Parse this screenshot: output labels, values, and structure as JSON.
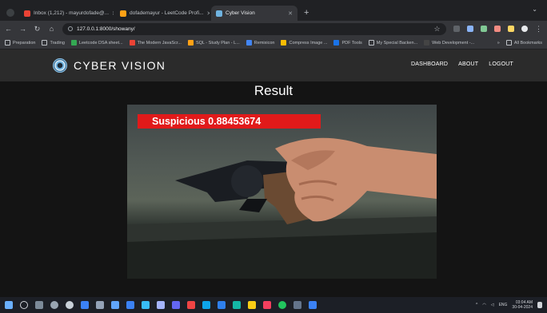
{
  "browser": {
    "tabs": [
      {
        "title": "Inbox (1,212) - mayurdofade@...",
        "favicon_color": "#ea4335",
        "active": false
      },
      {
        "title": "dofademayur - LeetCode Profi...",
        "favicon_color": "#ffa116",
        "active": false
      },
      {
        "title": "Cyber Vision",
        "favicon_color": "#6fb3e0",
        "active": true
      }
    ],
    "new_tab_glyph": "+",
    "window_menu_glyph": "⌄",
    "address": "127.0.0.1:8000/showany/",
    "bookmarks": [
      {
        "label": "Preparation",
        "icon_color": "#bdc1c6"
      },
      {
        "label": "Trading",
        "icon_color": "#bdc1c6"
      },
      {
        "label": "Leetcode DSA sheet...",
        "icon_color": "#34a853"
      },
      {
        "label": "The Modern JavaScr...",
        "icon_color": "#ea4335"
      },
      {
        "label": "SQL - Study Plan - L...",
        "icon_color": "#ffa116"
      },
      {
        "label": "Remixicon",
        "icon_color": "#4285f4"
      },
      {
        "label": "Compress Image ...",
        "icon_color": "#fbbc04"
      },
      {
        "label": "PDF Tools",
        "icon_color": "#1a73e8"
      },
      {
        "label": "My Special Backen...",
        "icon_color": "#bdc1c6"
      },
      {
        "label": "Web Development -...",
        "icon_color": "#444444"
      }
    ],
    "bookmarks_overflow": "»",
    "all_bookmarks": "All Bookmarks"
  },
  "site": {
    "brand": "CYBER VISION",
    "nav": [
      "DASHBOARD",
      "ABOUT",
      "LOGOUT"
    ],
    "heading": "Result",
    "detection": {
      "label": "Suspicious",
      "score": "0.88453674",
      "box_color": "#e11a1a"
    }
  },
  "taskbar": {
    "icons": [
      "windows-start",
      "search",
      "widgets",
      "settings",
      "app",
      "file-explorer",
      "app",
      "app",
      "app",
      "app",
      "app",
      "app",
      "app",
      "vscode",
      "app",
      "app",
      "app",
      "whatsapp",
      "app",
      "app"
    ],
    "time": "03:04 AM",
    "date": "30-04-2024",
    "lang": "ENG"
  },
  "colors": {
    "page_bg": "#141414",
    "nav_bg": "#2b2b2b",
    "chrome_bg": "#35363a"
  }
}
